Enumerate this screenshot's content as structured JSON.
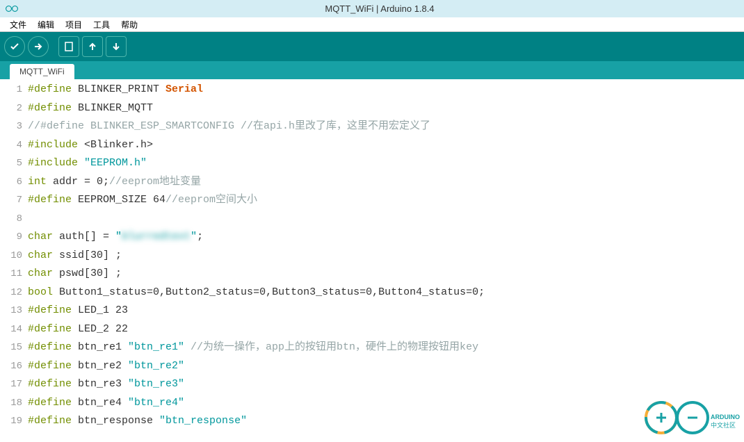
{
  "window": {
    "title": "MQTT_WiFi | Arduino 1.8.4"
  },
  "menu": {
    "file": "文件",
    "edit": "编辑",
    "sketch": "项目",
    "tools": "工具",
    "help": "帮助"
  },
  "tab": {
    "name": "MQTT_WiFi"
  },
  "toolbar_icons": {
    "verify": "verify-icon",
    "upload": "upload-icon",
    "new": "new-icon",
    "open": "open-icon",
    "save": "save-icon"
  },
  "code": {
    "l1": {
      "num": "1",
      "a": "#define",
      "b": " BLINKER_PRINT ",
      "c": "Serial"
    },
    "l2": {
      "num": "2",
      "a": "#define",
      "b": " BLINKER_MQTT"
    },
    "l3": {
      "num": "3",
      "a": "//#define BLINKER_ESP_SMARTCONFIG //在api.h里改了库，这里不用宏定义了"
    },
    "l4": {
      "num": "4",
      "a": "#include",
      "b": " <Blinker.h>"
    },
    "l5": {
      "num": "5",
      "a": "#include",
      "b": " ",
      "c": "\"EEPROM.h\""
    },
    "l6": {
      "num": "6",
      "a": "int",
      "b": " addr = 0;",
      "c": "//eeprom地址变量"
    },
    "l7": {
      "num": "7",
      "a": "#define",
      "b": " EEPROM_SIZE 64",
      "c": "//eeprom空间大小"
    },
    "l8": {
      "num": "8",
      "a": ""
    },
    "l9": {
      "num": "9",
      "a": "char",
      "b": " auth[] = ",
      "c": "\"",
      "d": "blurredtext",
      "e": "\"",
      "f": ";"
    },
    "l10": {
      "num": "10",
      "a": "char",
      "b": " ssid[30] ;"
    },
    "l11": {
      "num": "11",
      "a": "char",
      "b": " pswd[30] ;"
    },
    "l12": {
      "num": "12",
      "a": "bool",
      "b": " Button1_status=0,Button2_status=0,Button3_status=0,Button4_status=0;"
    },
    "l13": {
      "num": "13",
      "a": "#define",
      "b": " LED_1 23"
    },
    "l14": {
      "num": "14",
      "a": "#define",
      "b": " LED_2 22"
    },
    "l15": {
      "num": "15",
      "a": "#define",
      "b": " btn_re1 ",
      "c": "\"btn_re1\"",
      "d": " //为统一操作，app上的按钮用btn，硬件上的物理按钮用key"
    },
    "l16": {
      "num": "16",
      "a": "#define",
      "b": " btn_re2 ",
      "c": "\"btn_re2\""
    },
    "l17": {
      "num": "17",
      "a": "#define",
      "b": " btn_re3 ",
      "c": "\"btn_re3\""
    },
    "l18": {
      "num": "18",
      "a": "#define",
      "b": " btn_re4 ",
      "c": "\"btn_re4\""
    },
    "l19": {
      "num": "19",
      "a": "#define",
      "b": " btn_response ",
      "c": "\"btn_response\""
    }
  },
  "watermark": {
    "text1": "ARDUINO",
    "text2": "中文社区"
  }
}
